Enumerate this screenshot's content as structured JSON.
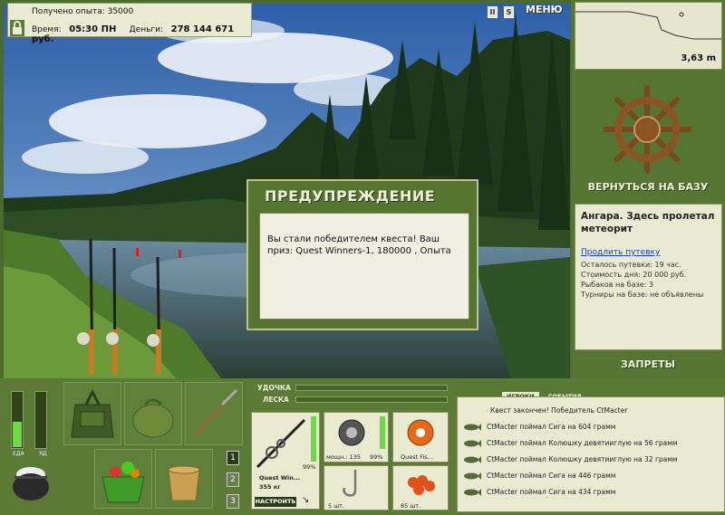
{
  "status": {
    "experience": "Получено опыта: 35000",
    "time_label": "Время:",
    "time_value": "05:30 ПН",
    "money_label": "Деньги:",
    "money_value": "278 144 671 руб."
  },
  "top_icons": {
    "pause": "II",
    "sound": "S",
    "menu": "МЕНЮ"
  },
  "depth": {
    "value": "3,63 m"
  },
  "right_panel": {
    "return_button": "ВЕРНУТЬСЯ НА БАЗУ",
    "info_title": "Ангара. Здесь пролетал метеорит",
    "extend_link": "Продлить путевку",
    "lines": [
      "Осталось путевки: 19 час.",
      "Стоимость дня: 20 000 руб.",
      "Рыбаков на базе: 3",
      "Турниры на базе: не объявлены"
    ],
    "bans_button": "ЗАПРЕТЫ"
  },
  "dialog": {
    "title": "ПРЕДУПРЕЖДЕНИЕ",
    "message": "Вы стали победителем квеста! Ваш приз: Quest Winners-1, 180000 , Опыта"
  },
  "bottom": {
    "food_label": "ЕДА",
    "water_label": "ЯД",
    "food_level": 0.45,
    "water_level": 0,
    "slots": [
      "1",
      "2",
      "3"
    ],
    "rod_label": "УДОЧКА",
    "line_label": "ЛЕСКА",
    "rod_name": "Quest Win...",
    "rod_weight": "355 кг",
    "rod_percent": "99%",
    "reel_power": "мощн.: 135",
    "reel_percent": "99%",
    "line_name": "Quest Fis...",
    "hooks_count": "5 шт.",
    "bait_count": "85 шт.",
    "setup_button": "НАСТРОИТЬ"
  },
  "events": {
    "tabs": [
      "ИГРОКИ",
      "СОБЫТИЯ"
    ],
    "header": "Квест закончен! Победитель CtMacter",
    "rows": [
      "CtMacter поймал Сига на 604 грамм",
      "CtMacter поймал Колюшку девятииглую на 56 грамм",
      "CtMacter поймал Колюшку девятииглую на 32 грамм",
      "CtMacter поймал Сига на 446 грамм",
      "CtMacter поймал Сига на 434 грамм"
    ]
  },
  "colors": {
    "panel": "#557533",
    "accent": "#6ed84a",
    "link": "#1b3fa8"
  }
}
